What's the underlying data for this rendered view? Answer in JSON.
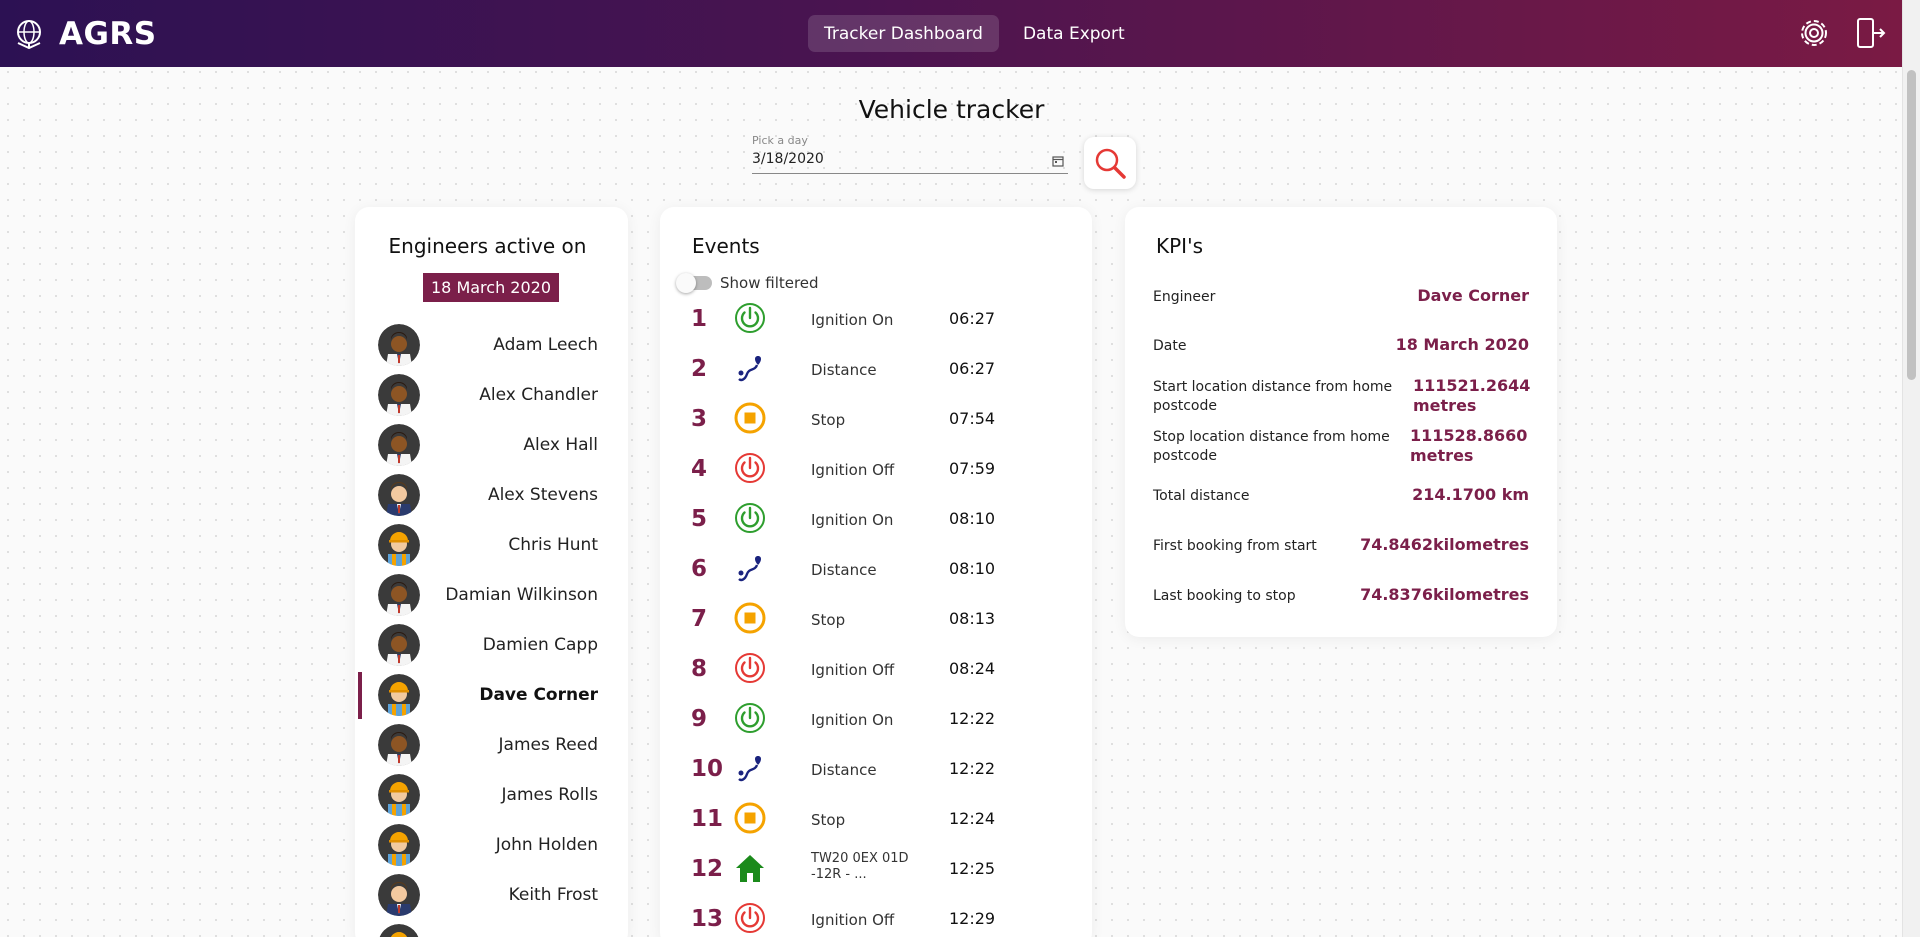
{
  "app": {
    "name": "AGRS",
    "nav": [
      "Tracker Dashboard",
      "Data Export"
    ]
  },
  "header": {
    "title": "Vehicle tracker",
    "date_label": "Pick a day",
    "date_value": "3/18/2020"
  },
  "engineers": {
    "heading": "Engineers active on",
    "date": "18 March 2020",
    "list": [
      {
        "name": "Adam Leech",
        "avatar": "dark-skin-suit"
      },
      {
        "name": "Alex Chandler",
        "avatar": "dark-skin-suit"
      },
      {
        "name": "Alex Hall",
        "avatar": "dark-skin-suit"
      },
      {
        "name": "Alex Stevens",
        "avatar": "navy-suit"
      },
      {
        "name": "Chris Hunt",
        "avatar": "hardhat"
      },
      {
        "name": "Damian Wilkinson",
        "avatar": "dark-skin-suit"
      },
      {
        "name": "Damien Capp",
        "avatar": "dark-skin-suit"
      },
      {
        "name": "Dave Corner",
        "avatar": "hardhat",
        "selected": true
      },
      {
        "name": "James Reed",
        "avatar": "dark-skin-suit"
      },
      {
        "name": "James Rolls",
        "avatar": "hardhat"
      },
      {
        "name": "John Holden",
        "avatar": "hardhat"
      },
      {
        "name": "Keith Frost",
        "avatar": "navy-suit"
      },
      {
        "name": "",
        "avatar": "hardhat"
      }
    ]
  },
  "events": {
    "heading": "Events",
    "toggle_label": "Show filtered",
    "list": [
      {
        "n": "1",
        "icon": "ignition-on-icon",
        "label": "Ignition On",
        "time": "06:27"
      },
      {
        "n": "2",
        "icon": "distance-icon",
        "label": "Distance",
        "time": "06:27"
      },
      {
        "n": "3",
        "icon": "stop-icon",
        "label": "Stop",
        "time": "07:54"
      },
      {
        "n": "4",
        "icon": "ignition-off-icon",
        "label": "Ignition Off",
        "time": "07:59"
      },
      {
        "n": "5",
        "icon": "ignition-on-icon",
        "label": "Ignition On",
        "time": "08:10"
      },
      {
        "n": "6",
        "icon": "distance-icon",
        "label": "Distance",
        "time": "08:10"
      },
      {
        "n": "7",
        "icon": "stop-icon",
        "label": "Stop",
        "time": "08:13"
      },
      {
        "n": "8",
        "icon": "ignition-off-icon",
        "label": "Ignition Off",
        "time": "08:24"
      },
      {
        "n": "9",
        "icon": "ignition-on-icon",
        "label": "Ignition On",
        "time": "12:22"
      },
      {
        "n": "10",
        "icon": "distance-icon",
        "label": "Distance",
        "time": "12:22"
      },
      {
        "n": "11",
        "icon": "stop-icon",
        "label": "Stop",
        "time": "12:24"
      },
      {
        "n": "12",
        "icon": "home-icon",
        "label": "TW20 0EX 01D -12R - ...",
        "time": "12:25"
      },
      {
        "n": "13",
        "icon": "ignition-off-icon",
        "label": "Ignition Off",
        "time": "12:29"
      }
    ]
  },
  "kpi": {
    "heading": "KPI's",
    "rows": [
      {
        "label": "Engineer",
        "value": "Dave Corner"
      },
      {
        "label": "Date",
        "value": "18 March 2020"
      },
      {
        "label": "Start location distance from home postcode",
        "value": "111521.2644 metres"
      },
      {
        "label": "Stop location distance from home postcode",
        "value": "111528.8660 metres"
      },
      {
        "label": "Total distance",
        "value": "214.1700 km"
      },
      {
        "label": "First booking from start",
        "value": "74.8462kilometres"
      },
      {
        "label": "Last booking to stop",
        "value": "74.8376kilometres"
      }
    ]
  },
  "colors": {
    "accent": "#7b1f4a",
    "ignition_on": "#2e9e2e",
    "ignition_off": "#e53935",
    "stop": "#f5a300",
    "distance": "#1a237e",
    "home": "#1b8a1b"
  }
}
